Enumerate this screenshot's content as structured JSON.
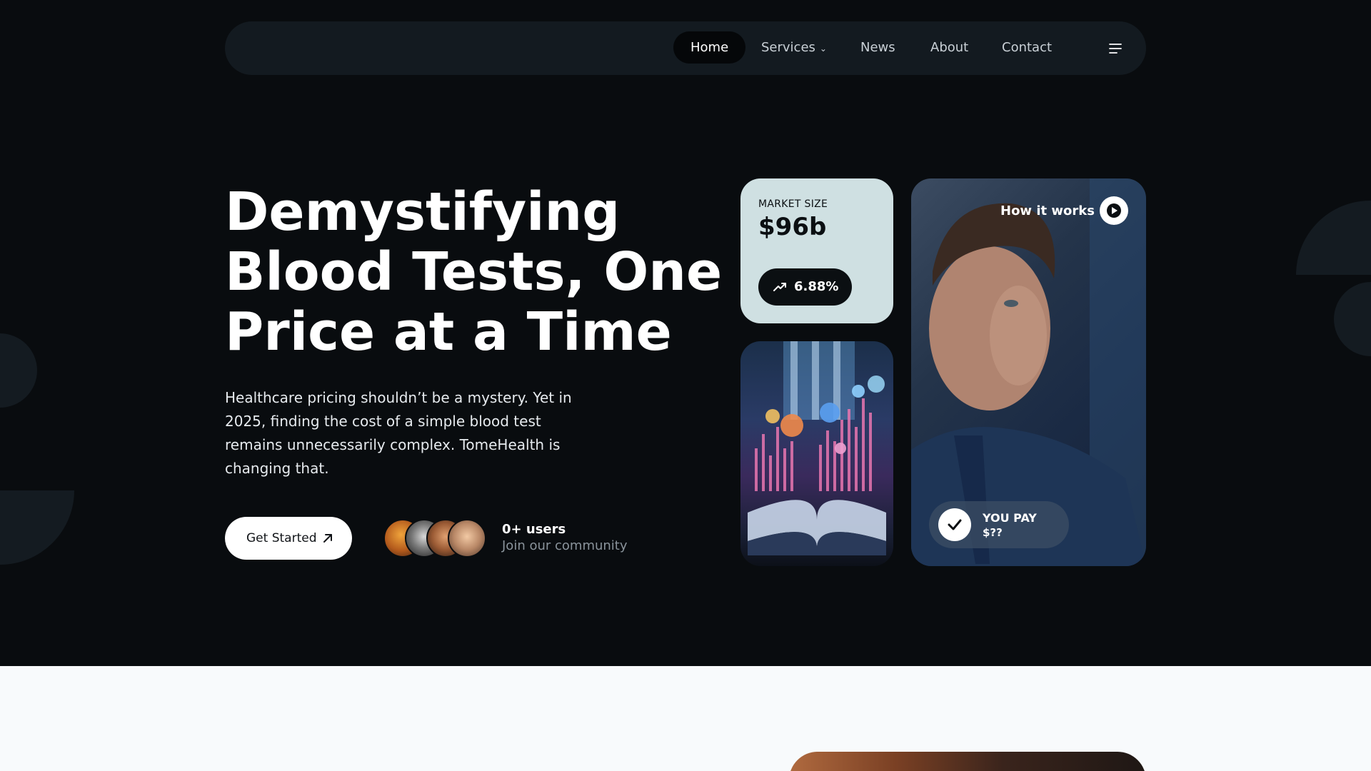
{
  "nav": {
    "items": [
      {
        "label": "Home",
        "active": true
      },
      {
        "label": "Services",
        "has_dropdown": true
      },
      {
        "label": "News"
      },
      {
        "label": "About"
      },
      {
        "label": "Contact"
      }
    ],
    "menu_icon": "menu-icon",
    "dropdown_icon": "chevron-down-icon"
  },
  "hero": {
    "title": "Demystifying Blood Tests, One Price at a Time",
    "description": "Healthcare pricing shouldn’t be a mystery. Yet in 2025, finding the cost of a simple blood test remains unnecessarily complex. TomeHealth is changing that.",
    "cta_label": "Get Started",
    "cta_icon": "arrow-up-right-icon",
    "users_count": "0+ users",
    "users_sub": "Join our community"
  },
  "market_card": {
    "label": "MARKET SIZE",
    "value": "$96b",
    "growth": "6.88%",
    "growth_icon": "trending-up-icon"
  },
  "video_card": {
    "label": "How it works",
    "play_icon": "play-icon",
    "pay_title": "YOU PAY",
    "pay_value": "$??",
    "check_icon": "check-icon"
  },
  "colors": {
    "hero_bg": "#090c0f",
    "nav_bg": "#131a20",
    "market_card_bg": "#cfe0e2",
    "lower_bg": "#f8fafc"
  }
}
